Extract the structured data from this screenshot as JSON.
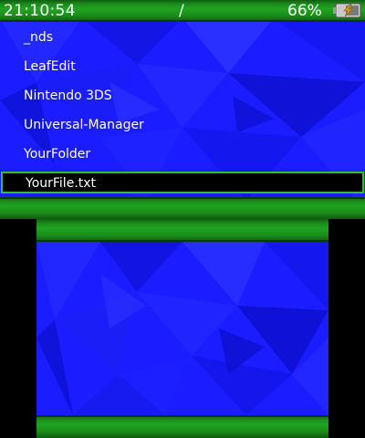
{
  "status_bar": {
    "time": "21:10:54",
    "path": "/",
    "battery_percent": "66%",
    "battery_icon": "battery-charging-icon"
  },
  "file_list": {
    "items": [
      {
        "label": "_nds",
        "selected": false
      },
      {
        "label": "LeafEdit",
        "selected": false
      },
      {
        "label": "Nintendo 3DS",
        "selected": false
      },
      {
        "label": "Universal-Manager",
        "selected": false
      },
      {
        "label": "YourFolder",
        "selected": false
      },
      {
        "label": "YourFile.txt",
        "selected": true
      }
    ]
  },
  "colors": {
    "background_blue": "#1b1cff",
    "bar_green": "#22a322",
    "selection_border": "#2fbf2f",
    "selection_fill": "#000000"
  }
}
